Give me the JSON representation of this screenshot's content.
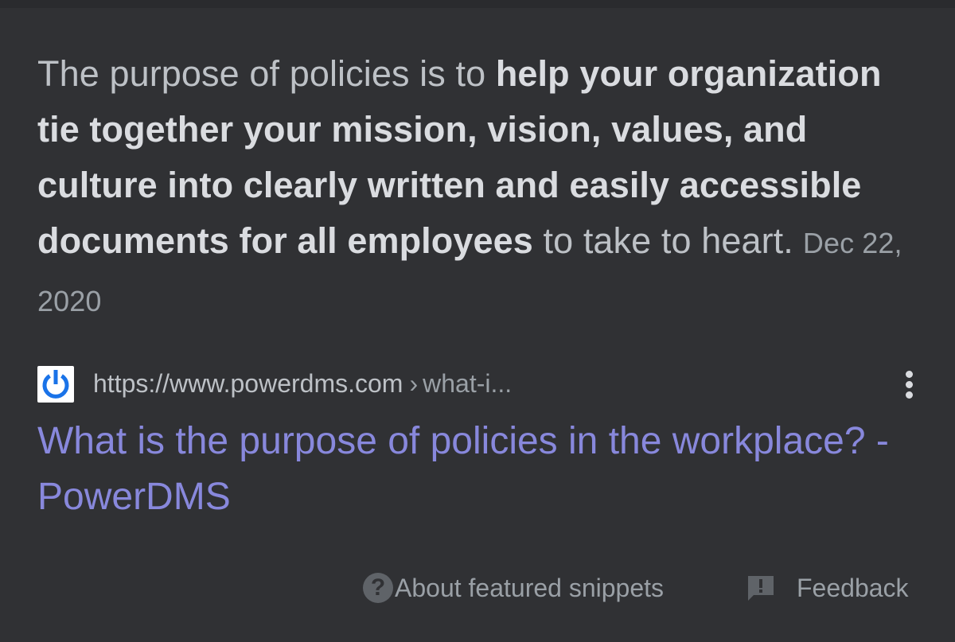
{
  "snippet": {
    "lead": "The purpose of policies is to ",
    "bold": "help your organization tie together your mission, vision, values, and culture into clearly written and easily accessible documents for all employees",
    "tail": " to take to heart.",
    "date": "Dec 22, 2020"
  },
  "source": {
    "favicon": "power-icon",
    "domain": "https://www.powerdms.com",
    "separator": "›",
    "path": "what-i...",
    "menu_icon": "more-vert-icon"
  },
  "result": {
    "title": "What is the purpose of policies in the workplace? - PowerDMS",
    "link_color": "#8888dc"
  },
  "footer": {
    "about_icon": "help-icon",
    "about_icon_glyph": "?",
    "about_label": "About featured snippets",
    "feedback_icon": "feedback-icon",
    "feedback_label": "Feedback"
  },
  "colors": {
    "background": "#303134",
    "text": "#bdc1c6",
    "text_bold": "#dadce0",
    "muted": "#9aa0a6",
    "favicon_blue": "#1a73e8"
  }
}
